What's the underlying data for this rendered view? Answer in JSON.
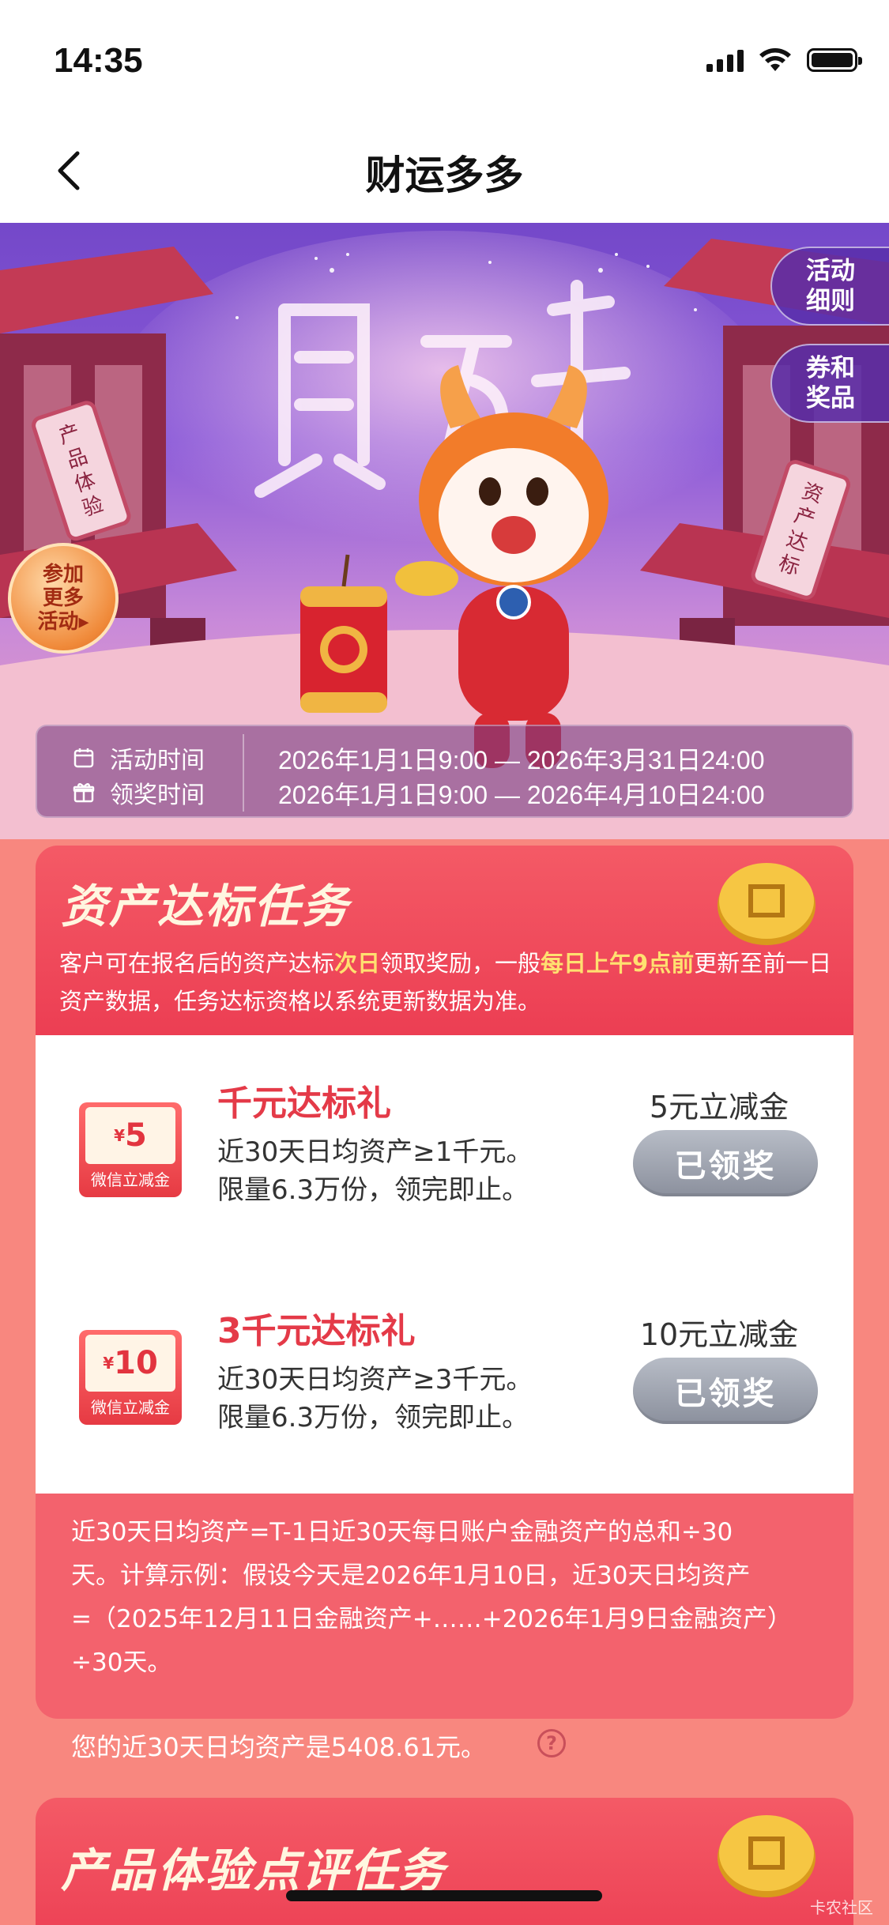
{
  "status_bar": {
    "time": "14:35"
  },
  "nav": {
    "title": "财运多多"
  },
  "hero": {
    "side_tabs": [
      {
        "label": "活动\n细则"
      },
      {
        "label": "券和\n奖品"
      }
    ],
    "join_badge": "参加\n更多\n活动▸",
    "time_panel": {
      "activity_label": "活动时间",
      "activity_value": "2026年1月1日9:00 — 2026年3月31日24:00",
      "claim_label": "领奖时间",
      "claim_value": "2026年1月1日9:00 — 2026年4月10日24:00"
    }
  },
  "asset_task": {
    "title": "资产达标任务",
    "desc_parts": [
      "客户可在报名后的资产达标",
      "次日",
      "领取奖励，一般",
      "每日上午9点前",
      "更新至前一日资产数据，任务达标资格以系统更新数据为准。"
    ],
    "tasks": [
      {
        "ticket_amount": "5",
        "ticket_currency": "¥",
        "ticket_caption": "微信立减金",
        "title": "千元达标礼",
        "line1": "近30天日均资产≥1千元。",
        "line2": "限量6.3万份，领完即止。",
        "reward": "5元立减金",
        "button": "已领奖"
      },
      {
        "ticket_amount": "10",
        "ticket_currency": "¥",
        "ticket_caption": "微信立减金",
        "title": "3千元达标礼",
        "line1": "近30天日均资产≥3千元。",
        "line2": "限量6.3万份，领完即止。",
        "reward": "10元立减金",
        "button": "已领奖"
      }
    ],
    "formula_lines": [
      "近30天日均资产=T-1日近30天每日账户金融资产的总和÷30",
      "天。计算示例：假设今天是2026年1月10日，近30天日均资产",
      "=（2025年12月11日金融资产+……+2026年1月9日金融资产）",
      "÷30天。"
    ],
    "my_asset": "您的近30天日均资产是5408.61元。",
    "help_icon": "?"
  },
  "product_task": {
    "title": "产品体验点评任务"
  },
  "watermark": "卡农社区",
  "colors": {
    "accent_red": "#ec3e53",
    "highlight_yellow": "#ffe070",
    "page_bg": "#f8877f",
    "claimed_gray": "#8b909d"
  }
}
